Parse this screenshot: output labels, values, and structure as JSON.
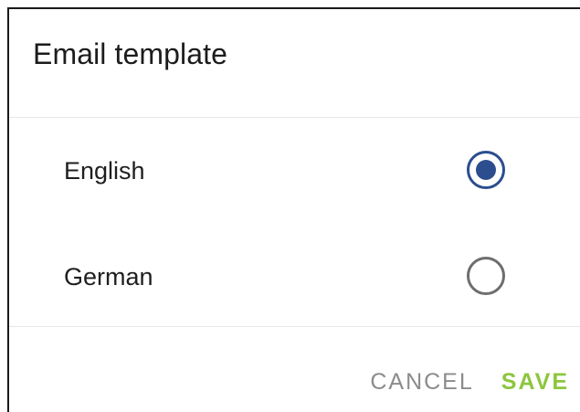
{
  "dialog": {
    "title": "Email template",
    "options": [
      {
        "label": "English",
        "selected": true
      },
      {
        "label": "German",
        "selected": false
      }
    ],
    "actions": {
      "cancel_label": "CANCEL",
      "save_label": "SAVE"
    }
  },
  "colors": {
    "radio_selected": "#2c4e8f",
    "radio_unselected": "#6e6e6e",
    "cancel_text": "#8c8c8c",
    "save_text": "#8cc63e",
    "divider": "#e6e6e6"
  },
  "icons": {
    "selected_radio": "radio-checked-icon",
    "unselected_radio": "radio-unchecked-icon"
  }
}
